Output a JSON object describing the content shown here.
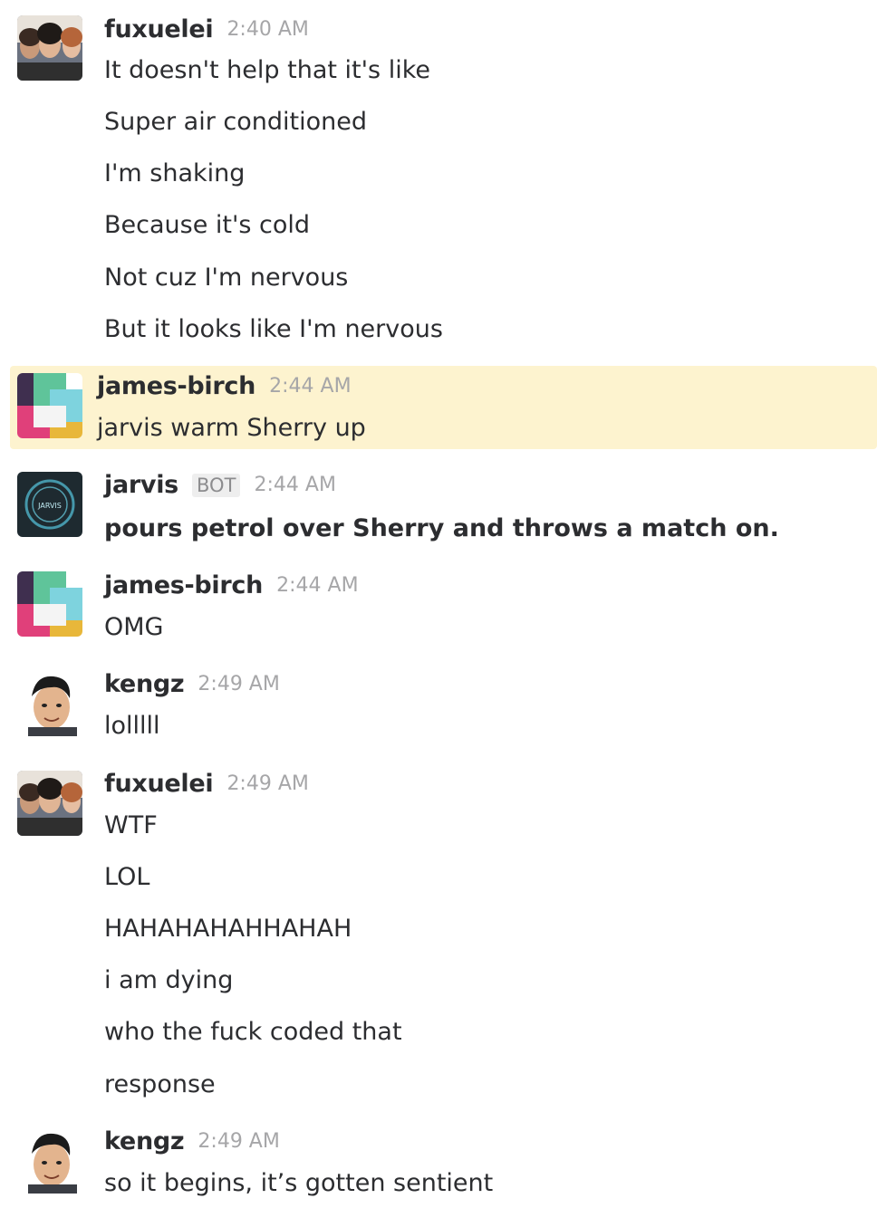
{
  "messages": [
    {
      "user": "fuxuelei",
      "time": "2:40 AM",
      "avatar": "group-selfie-avatar",
      "lines": [
        "It doesn't help that it's like",
        "Super air conditioned",
        "I'm shaking",
        "Because it's cold",
        "Not cuz I'm nervous",
        "But it looks like I'm nervous"
      ]
    },
    {
      "user": "james-birch",
      "time": "2:44 AM",
      "avatar": "pinwheel-avatar",
      "highlighted": true,
      "lines": [
        "jarvis warm Sherry up"
      ]
    },
    {
      "user": "jarvis",
      "badge": "BOT",
      "time": "2:44 AM",
      "avatar": "jarvis-ring-avatar",
      "avatar_text": "JARVIS",
      "lines": [
        "pours petrol over  Sherry and throws a match on."
      ]
    },
    {
      "user": "james-birch",
      "time": "2:44 AM",
      "avatar": "pinwheel-avatar",
      "lines": [
        "OMG"
      ]
    },
    {
      "user": "kengz",
      "time": "2:49 AM",
      "avatar": "face-avatar",
      "lines": [
        "lolllll"
      ]
    },
    {
      "user": "fuxuelei",
      "time": "2:49 AM",
      "avatar": "group-selfie-avatar",
      "lines": [
        "WTF",
        "LOL",
        "HAHAHAHAHHAHAH",
        "i am dying",
        "who the fuck coded that",
        "response"
      ]
    },
    {
      "user": "kengz",
      "time": "2:49 AM",
      "avatar": "face-avatar",
      "lines": [
        "so it begins, it’s gotten sentient"
      ]
    }
  ],
  "colors": {
    "highlight": "#fdf3cf",
    "username": "#2c2d30",
    "timestamp": "#a6a6a8"
  }
}
